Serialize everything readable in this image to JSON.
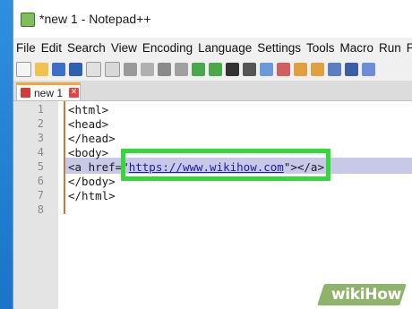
{
  "window": {
    "title": "*new 1 - Notepad++"
  },
  "menubar": {
    "items": [
      "File",
      "Edit",
      "Search",
      "View",
      "Encoding",
      "Language",
      "Settings",
      "Tools",
      "Macro",
      "Run",
      "Plugi"
    ]
  },
  "toolbar": {
    "icons": [
      "new-file-icon",
      "open-file-icon",
      "save-icon",
      "save-all-icon",
      "close-icon",
      "close-all-icon",
      "print-icon",
      "cut-icon",
      "copy-icon",
      "paste-icon",
      "undo-icon",
      "redo-icon",
      "find-icon",
      "replace-icon",
      "zoom-in-icon",
      "zoom-out-icon",
      "sync-v-icon",
      "sync-h-icon",
      "wrap-icon",
      "show-all-icon",
      "indent-guide-icon"
    ]
  },
  "tabs": [
    {
      "label": "new 1",
      "close": "✕"
    }
  ],
  "editor": {
    "lines": [
      {
        "num": "1",
        "text": "<html>"
      },
      {
        "num": "2",
        "text": "<head>"
      },
      {
        "num": "3",
        "text": "</head>"
      },
      {
        "num": "4",
        "text": "<body>"
      },
      {
        "num": "5",
        "prefix": "<a href=\"",
        "url": "https://www.wikihow.com",
        "suffix": "\"></a>"
      },
      {
        "num": "6",
        "text": "</body>"
      },
      {
        "num": "7",
        "text": "</html>"
      },
      {
        "num": "8",
        "text": ""
      }
    ]
  },
  "watermark": {
    "brand1": "wiki",
    "brand2": "How"
  },
  "colors": {
    "highlight_box": "#35d83a",
    "current_line": "#c8c8e8",
    "fold_line": "#c97a35"
  }
}
